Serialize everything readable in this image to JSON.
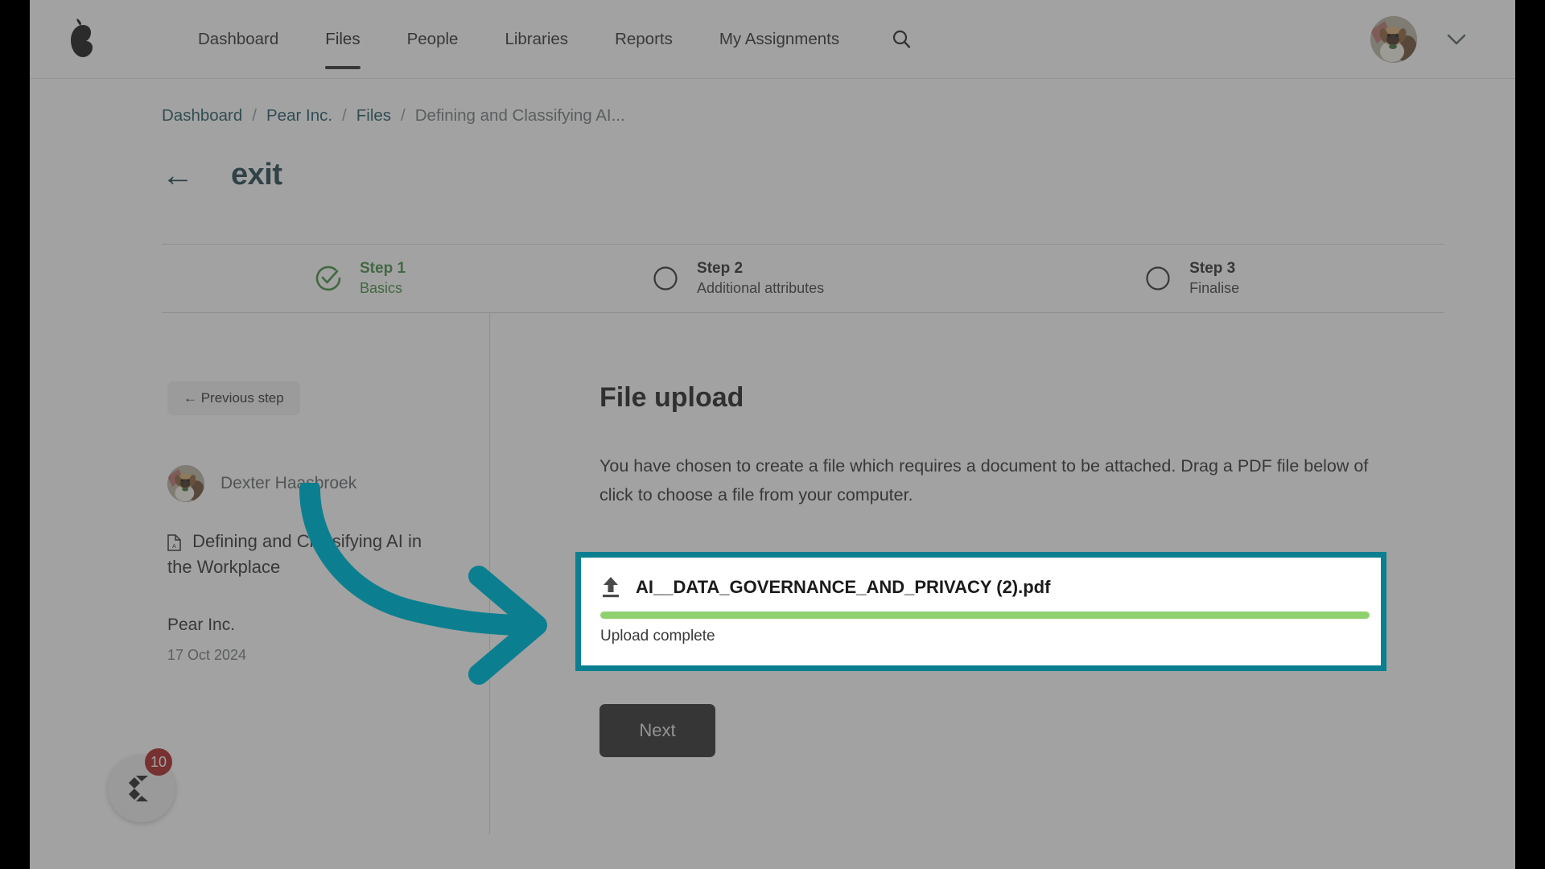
{
  "header": {
    "logo_icon": "pear-logo-icon",
    "nav_items": [
      {
        "label": "Dashboard",
        "active": false
      },
      {
        "label": "Files",
        "active": true
      },
      {
        "label": "People",
        "active": false
      },
      {
        "label": "Libraries",
        "active": false
      },
      {
        "label": "Reports",
        "active": false
      },
      {
        "label": "My Assignments",
        "active": false
      }
    ],
    "search_icon": "search-icon",
    "avatar_icon": "user-avatar-dog",
    "chevron_icon": "chevron-down-icon"
  },
  "breadcrumb": {
    "items": [
      "Dashboard",
      "Pear Inc.",
      "Files"
    ],
    "separator": "/",
    "current": "Defining and Classifying AI..."
  },
  "exit": {
    "arrow": "←",
    "label": "exit"
  },
  "stepper": {
    "steps": [
      {
        "title": "Step 1",
        "subtitle": "Basics",
        "state": "done",
        "icon": "check-circle-icon"
      },
      {
        "title": "Step 2",
        "subtitle": "Additional attributes",
        "state": "pending",
        "icon": "circle-icon"
      },
      {
        "title": "Step 3",
        "subtitle": "Finalise",
        "state": "pending",
        "icon": "circle-icon"
      }
    ]
  },
  "sidebar": {
    "previous_step_label": "← Previous step",
    "author": "Dexter Haasbroek",
    "document_title": "Defining and Classifying AI in the Workplace",
    "organisation": "Pear Inc.",
    "date": "17 Oct 2024",
    "doc_icon": "pdf-file-icon"
  },
  "main": {
    "title": "File upload",
    "description": "You have chosen to create a file which requires a document to be attached. Drag a PDF file below of click to choose a file from your computer.",
    "upload": {
      "icon": "upload-icon",
      "filename": "AI__DATA_GOVERNANCE_AND_PRIVACY (2).pdf",
      "progress_percent": 100,
      "status": "Upload complete",
      "highlight_color": "#0b7f90",
      "progress_color": "#8ed16e"
    },
    "next_label": "Next"
  },
  "chat_widget": {
    "icon": "chat-logo-icon",
    "badge_count": "10",
    "badge_color": "#a81d1d"
  },
  "annotation": {
    "arrow_color": "#0b7f90",
    "type": "curved-arrow-right"
  },
  "colors": {
    "accent_teal": "#0b7f90",
    "link_teal": "#1d5360",
    "step_green": "#3f8b3f",
    "dark_button": "#262626"
  }
}
